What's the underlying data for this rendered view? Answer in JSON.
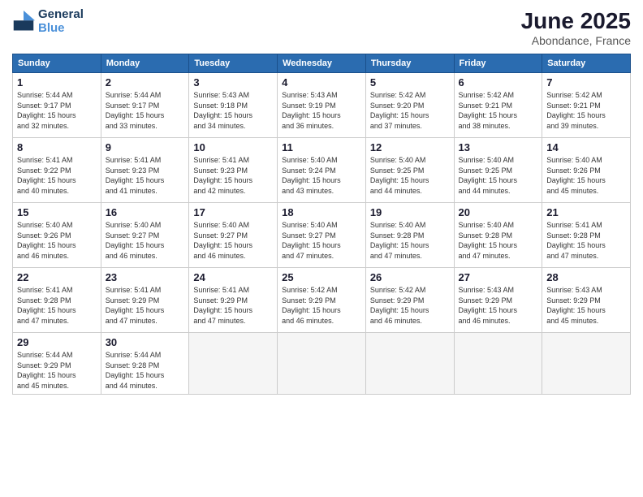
{
  "logo": {
    "line1": "General",
    "line2": "Blue"
  },
  "title": "June 2025",
  "subtitle": "Abondance, France",
  "days_of_week": [
    "Sunday",
    "Monday",
    "Tuesday",
    "Wednesday",
    "Thursday",
    "Friday",
    "Saturday"
  ],
  "weeks": [
    [
      {
        "day": "1",
        "sunrise": "5:44 AM",
        "sunset": "9:17 PM",
        "daylight": "15 hours and 32 minutes."
      },
      {
        "day": "2",
        "sunrise": "5:44 AM",
        "sunset": "9:17 PM",
        "daylight": "15 hours and 33 minutes."
      },
      {
        "day": "3",
        "sunrise": "5:43 AM",
        "sunset": "9:18 PM",
        "daylight": "15 hours and 34 minutes."
      },
      {
        "day": "4",
        "sunrise": "5:43 AM",
        "sunset": "9:19 PM",
        "daylight": "15 hours and 36 minutes."
      },
      {
        "day": "5",
        "sunrise": "5:42 AM",
        "sunset": "9:20 PM",
        "daylight": "15 hours and 37 minutes."
      },
      {
        "day": "6",
        "sunrise": "5:42 AM",
        "sunset": "9:21 PM",
        "daylight": "15 hours and 38 minutes."
      },
      {
        "day": "7",
        "sunrise": "5:42 AM",
        "sunset": "9:21 PM",
        "daylight": "15 hours and 39 minutes."
      }
    ],
    [
      {
        "day": "8",
        "sunrise": "5:41 AM",
        "sunset": "9:22 PM",
        "daylight": "15 hours and 40 minutes."
      },
      {
        "day": "9",
        "sunrise": "5:41 AM",
        "sunset": "9:23 PM",
        "daylight": "15 hours and 41 minutes."
      },
      {
        "day": "10",
        "sunrise": "5:41 AM",
        "sunset": "9:23 PM",
        "daylight": "15 hours and 42 minutes."
      },
      {
        "day": "11",
        "sunrise": "5:40 AM",
        "sunset": "9:24 PM",
        "daylight": "15 hours and 43 minutes."
      },
      {
        "day": "12",
        "sunrise": "5:40 AM",
        "sunset": "9:25 PM",
        "daylight": "15 hours and 44 minutes."
      },
      {
        "day": "13",
        "sunrise": "5:40 AM",
        "sunset": "9:25 PM",
        "daylight": "15 hours and 44 minutes."
      },
      {
        "day": "14",
        "sunrise": "5:40 AM",
        "sunset": "9:26 PM",
        "daylight": "15 hours and 45 minutes."
      }
    ],
    [
      {
        "day": "15",
        "sunrise": "5:40 AM",
        "sunset": "9:26 PM",
        "daylight": "15 hours and 46 minutes."
      },
      {
        "day": "16",
        "sunrise": "5:40 AM",
        "sunset": "9:27 PM",
        "daylight": "15 hours and 46 minutes."
      },
      {
        "day": "17",
        "sunrise": "5:40 AM",
        "sunset": "9:27 PM",
        "daylight": "15 hours and 46 minutes."
      },
      {
        "day": "18",
        "sunrise": "5:40 AM",
        "sunset": "9:27 PM",
        "daylight": "15 hours and 47 minutes."
      },
      {
        "day": "19",
        "sunrise": "5:40 AM",
        "sunset": "9:28 PM",
        "daylight": "15 hours and 47 minutes."
      },
      {
        "day": "20",
        "sunrise": "5:40 AM",
        "sunset": "9:28 PM",
        "daylight": "15 hours and 47 minutes."
      },
      {
        "day": "21",
        "sunrise": "5:41 AM",
        "sunset": "9:28 PM",
        "daylight": "15 hours and 47 minutes."
      }
    ],
    [
      {
        "day": "22",
        "sunrise": "5:41 AM",
        "sunset": "9:28 PM",
        "daylight": "15 hours and 47 minutes."
      },
      {
        "day": "23",
        "sunrise": "5:41 AM",
        "sunset": "9:29 PM",
        "daylight": "15 hours and 47 minutes."
      },
      {
        "day": "24",
        "sunrise": "5:41 AM",
        "sunset": "9:29 PM",
        "daylight": "15 hours and 47 minutes."
      },
      {
        "day": "25",
        "sunrise": "5:42 AM",
        "sunset": "9:29 PM",
        "daylight": "15 hours and 46 minutes."
      },
      {
        "day": "26",
        "sunrise": "5:42 AM",
        "sunset": "9:29 PM",
        "daylight": "15 hours and 46 minutes."
      },
      {
        "day": "27",
        "sunrise": "5:43 AM",
        "sunset": "9:29 PM",
        "daylight": "15 hours and 46 minutes."
      },
      {
        "day": "28",
        "sunrise": "5:43 AM",
        "sunset": "9:29 PM",
        "daylight": "15 hours and 45 minutes."
      }
    ],
    [
      {
        "day": "29",
        "sunrise": "5:44 AM",
        "sunset": "9:29 PM",
        "daylight": "15 hours and 45 minutes."
      },
      {
        "day": "30",
        "sunrise": "5:44 AM",
        "sunset": "9:28 PM",
        "daylight": "15 hours and 44 minutes."
      },
      null,
      null,
      null,
      null,
      null
    ]
  ]
}
